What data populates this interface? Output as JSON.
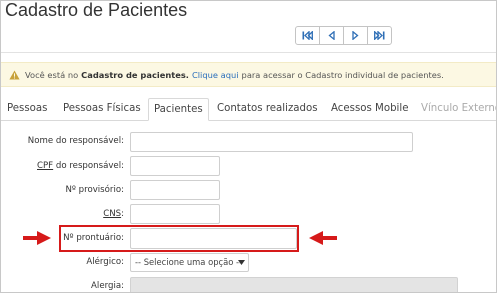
{
  "page": {
    "title": "Cadastro de Pacientes"
  },
  "pager": {
    "buttons": [
      {
        "name": "first-record-button",
        "icon": "skip-first-icon"
      },
      {
        "name": "previous-record-button",
        "icon": "triangle-left-icon"
      },
      {
        "name": "next-record-button",
        "icon": "triangle-right-icon"
      },
      {
        "name": "last-record-button",
        "icon": "skip-last-icon"
      }
    ]
  },
  "alert": {
    "icon": "warning-icon",
    "prefix": "Você está no",
    "bold": "Cadastro de pacientes.",
    "link": "Clique aqui",
    "suffix": "para acessar o Cadastro individual de pacientes."
  },
  "tabs": [
    {
      "label": "Pessoas"
    },
    {
      "label": "Pessoas Físicas"
    },
    {
      "label": "Pacientes",
      "active": true
    },
    {
      "label": "Contatos realizados"
    },
    {
      "label": "Acessos Mobile"
    },
    {
      "label": "Vínculo Externo",
      "disabled": true
    }
  ],
  "form": {
    "responsavel_label": "Nome do responsável:",
    "cpf_abbr": "CPF",
    "cpf_rest": "do responsável:",
    "provisorio_label": "Nº provisório:",
    "cns_label": "CNS",
    "cns_colon": ":",
    "prontuario_label": "Nº prontuário:",
    "alergico_label": "Alérgico:",
    "alergico_value": "-- Selecione uma opção --",
    "alergia_label": "Alergia:"
  },
  "colors": {
    "highlight": "#d61a1a",
    "alert_bg": "#fcf8e3",
    "link": "#2a6ebb"
  }
}
